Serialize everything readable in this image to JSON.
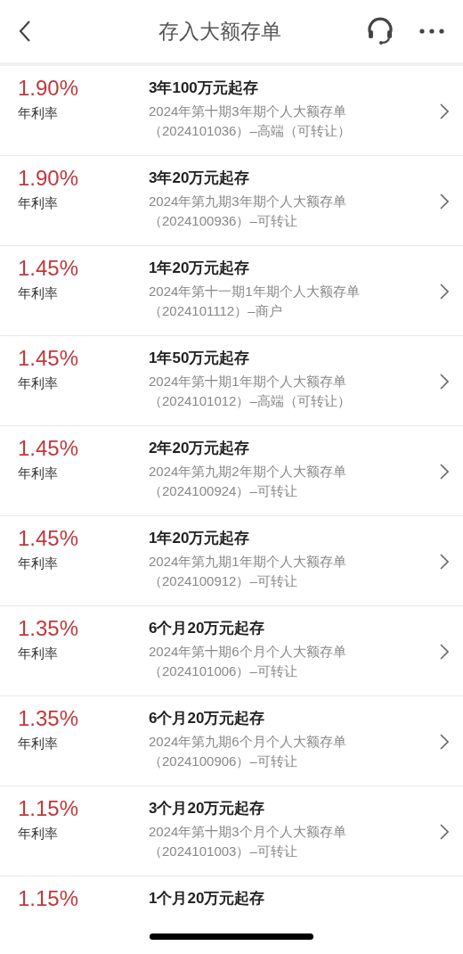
{
  "header": {
    "title": "存入大额存单"
  },
  "products": [
    {
      "rate": "1.90%",
      "rate_label": "年利率",
      "title": "3年100万元起存",
      "desc": [
        "2024年第十期3年期个人大额存单",
        "（2024101036）–高端（可转让）"
      ]
    },
    {
      "rate": "1.90%",
      "rate_label": "年利率",
      "title": "3年20万元起存",
      "desc": [
        "2024年第九期3年期个人大额存单",
        "（2024100936）–可转让"
      ]
    },
    {
      "rate": "1.45%",
      "rate_label": "年利率",
      "title": "1年20万元起存",
      "desc": [
        "2024年第十一期1年期个人大额存单",
        "（2024101112）–商户"
      ]
    },
    {
      "rate": "1.45%",
      "rate_label": "年利率",
      "title": "1年50万元起存",
      "desc": [
        "2024年第十期1年期个人大额存单",
        "（2024101012）–高端（可转让）"
      ]
    },
    {
      "rate": "1.45%",
      "rate_label": "年利率",
      "title": "2年20万元起存",
      "desc": [
        "2024年第九期2年期个人大额存单",
        "（2024100924）–可转让"
      ]
    },
    {
      "rate": "1.45%",
      "rate_label": "年利率",
      "title": "1年20万元起存",
      "desc": [
        "2024年第九期1年期个人大额存单",
        "（2024100912）–可转让"
      ]
    },
    {
      "rate": "1.35%",
      "rate_label": "年利率",
      "title": "6个月20万元起存",
      "desc": [
        "2024年第十期6个月个人大额存单",
        "（2024101006）–可转让"
      ]
    },
    {
      "rate": "1.35%",
      "rate_label": "年利率",
      "title": "6个月20万元起存",
      "desc": [
        "2024年第九期6个月个人大额存单",
        "（2024100906）–可转让"
      ]
    },
    {
      "rate": "1.15%",
      "rate_label": "年利率",
      "title": "3个月20万元起存",
      "desc": [
        "2024年第十期3个月个人大额存单",
        "（2024101003）–可转让"
      ]
    },
    {
      "rate": "1.15%",
      "title": "1个月20万元起存"
    }
  ]
}
